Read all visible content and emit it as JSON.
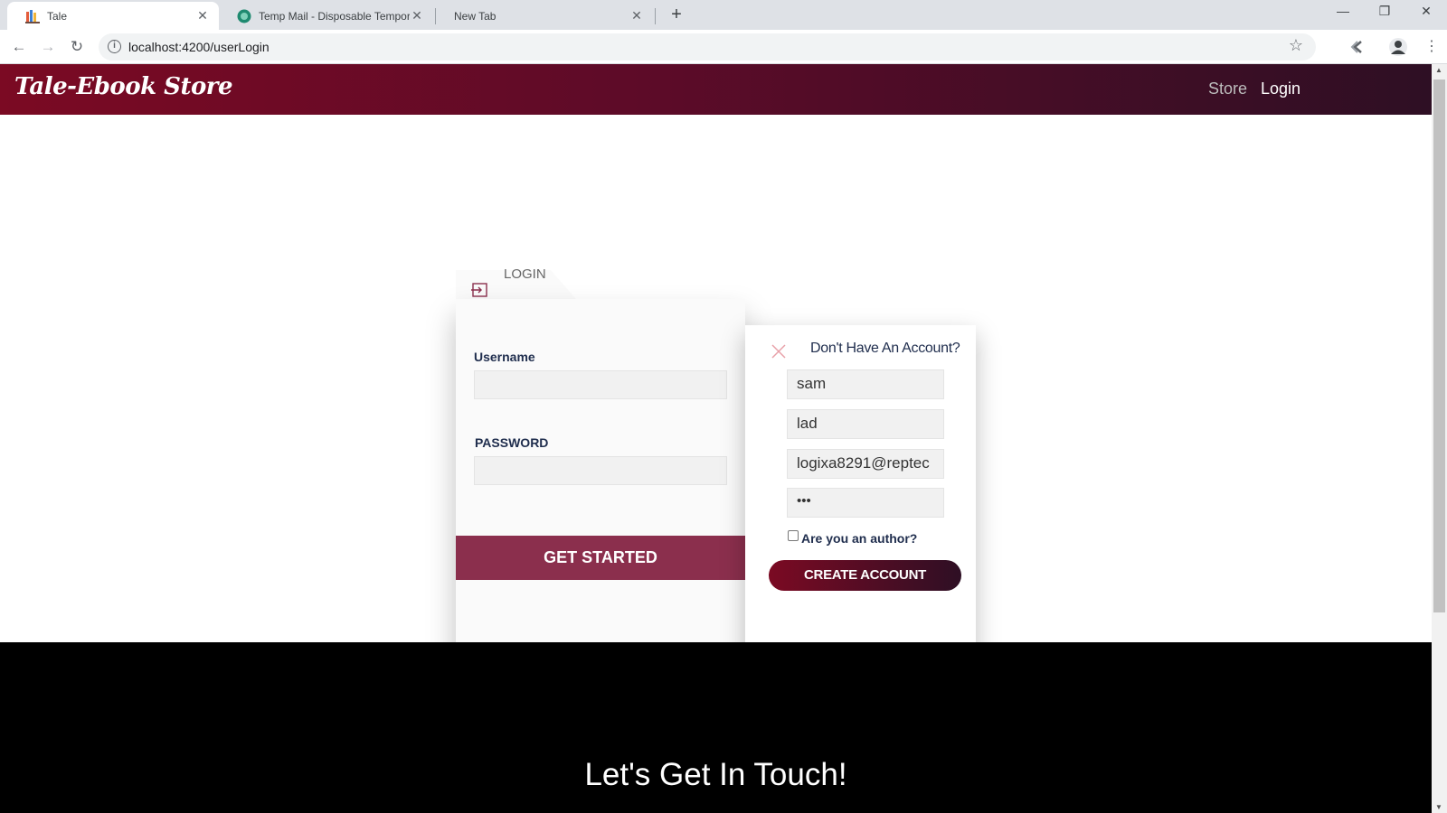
{
  "browser": {
    "tabs": [
      {
        "title": "Tale",
        "active": true
      },
      {
        "title": "Temp Mail - Disposable Tempora",
        "active": false
      },
      {
        "title": "New Tab",
        "active": false
      }
    ],
    "url": "localhost:4200/userLogin"
  },
  "navbar": {
    "brand": "Tale-Ebook Store",
    "links": [
      "Store",
      "Login"
    ]
  },
  "login": {
    "tab_label": "LOGIN",
    "username_label": "Username",
    "username_value": "",
    "password_label": "PASSWORD",
    "password_value": "",
    "submit_label": "GET STARTED"
  },
  "signup": {
    "title": "Don't Have An Account?",
    "fields": [
      "sam",
      "lad",
      "logixa8291@reptec",
      "•••"
    ],
    "author_checkbox_label": "Are you an author?",
    "author_checked": false,
    "submit_label": "CREATE ACCOUNT"
  },
  "footer": {
    "title": "Let's Get In Touch!"
  },
  "colors": {
    "brand_dark": "#7b0a23",
    "brand_deep": "#2e0f24",
    "button_maroon": "#8b2f4d"
  }
}
